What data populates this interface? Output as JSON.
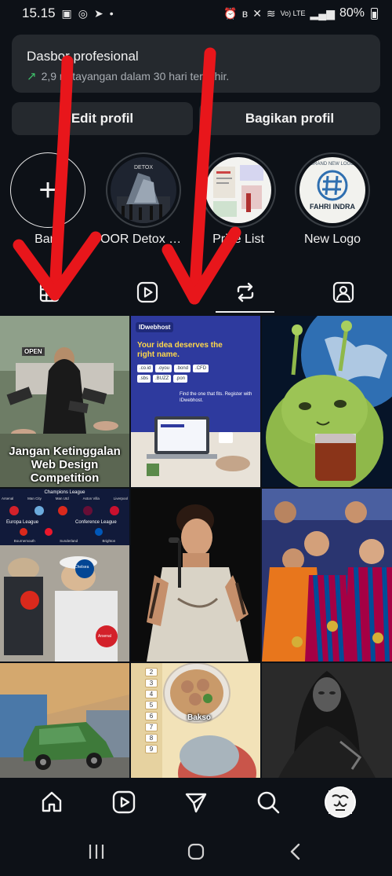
{
  "status_bar": {
    "time": "15.15",
    "battery": "80%",
    "network": "Vo) LTE"
  },
  "pro_dashboard": {
    "title": "Dasbor profesional",
    "subtitle": "2,9 rb tayangan dalam 30 hari terakhir."
  },
  "buttons": {
    "edit_profile": "Edit profil",
    "share_profile": "Bagikan profil"
  },
  "highlights": [
    {
      "label": "Baru"
    },
    {
      "label": "OOR Detox JK..."
    },
    {
      "label": "Price List"
    },
    {
      "label": "New Logo"
    }
  ],
  "posts": {
    "post1": {
      "title": "Jangan Ketinggalan Web Design Competition",
      "sign": "OPEN"
    },
    "post2": {
      "brand": "IDwebhost",
      "headline": "Your idea deserves the right name.",
      "cta": "Find the one that fits. Register with IDwebhost.",
      "domains": [
        ".co.id",
        ".oyou",
        ".bond",
        ".CFD",
        ".sbs",
        ".BUZZ",
        ".pon"
      ]
    },
    "post4": {
      "top": "Champions League",
      "mid": "Europa League",
      "right": "Conference League",
      "teams": [
        "Arsenal",
        "Man City",
        "Man Utd",
        "Aston Villa",
        "Liverpool",
        "Bournemouth",
        "Sunderland",
        "Brighton"
      ],
      "clubs": [
        "Chelsea",
        "Arsenal"
      ]
    },
    "post8": {
      "label": "Bakso",
      "numbers": [
        "2",
        "3",
        "4",
        "5",
        "6",
        "7",
        "8",
        "9"
      ]
    }
  },
  "highlight_texts": {
    "new_logo_top": "BRAND NEW LOGO",
    "new_logo_name": "FAHRI INDRA",
    "oor_top": "DETOX"
  },
  "colors": {
    "background": "#0d1117",
    "card": "#25292e",
    "trend_green": "#3fc16a",
    "annotation_red": "#e8161b"
  }
}
